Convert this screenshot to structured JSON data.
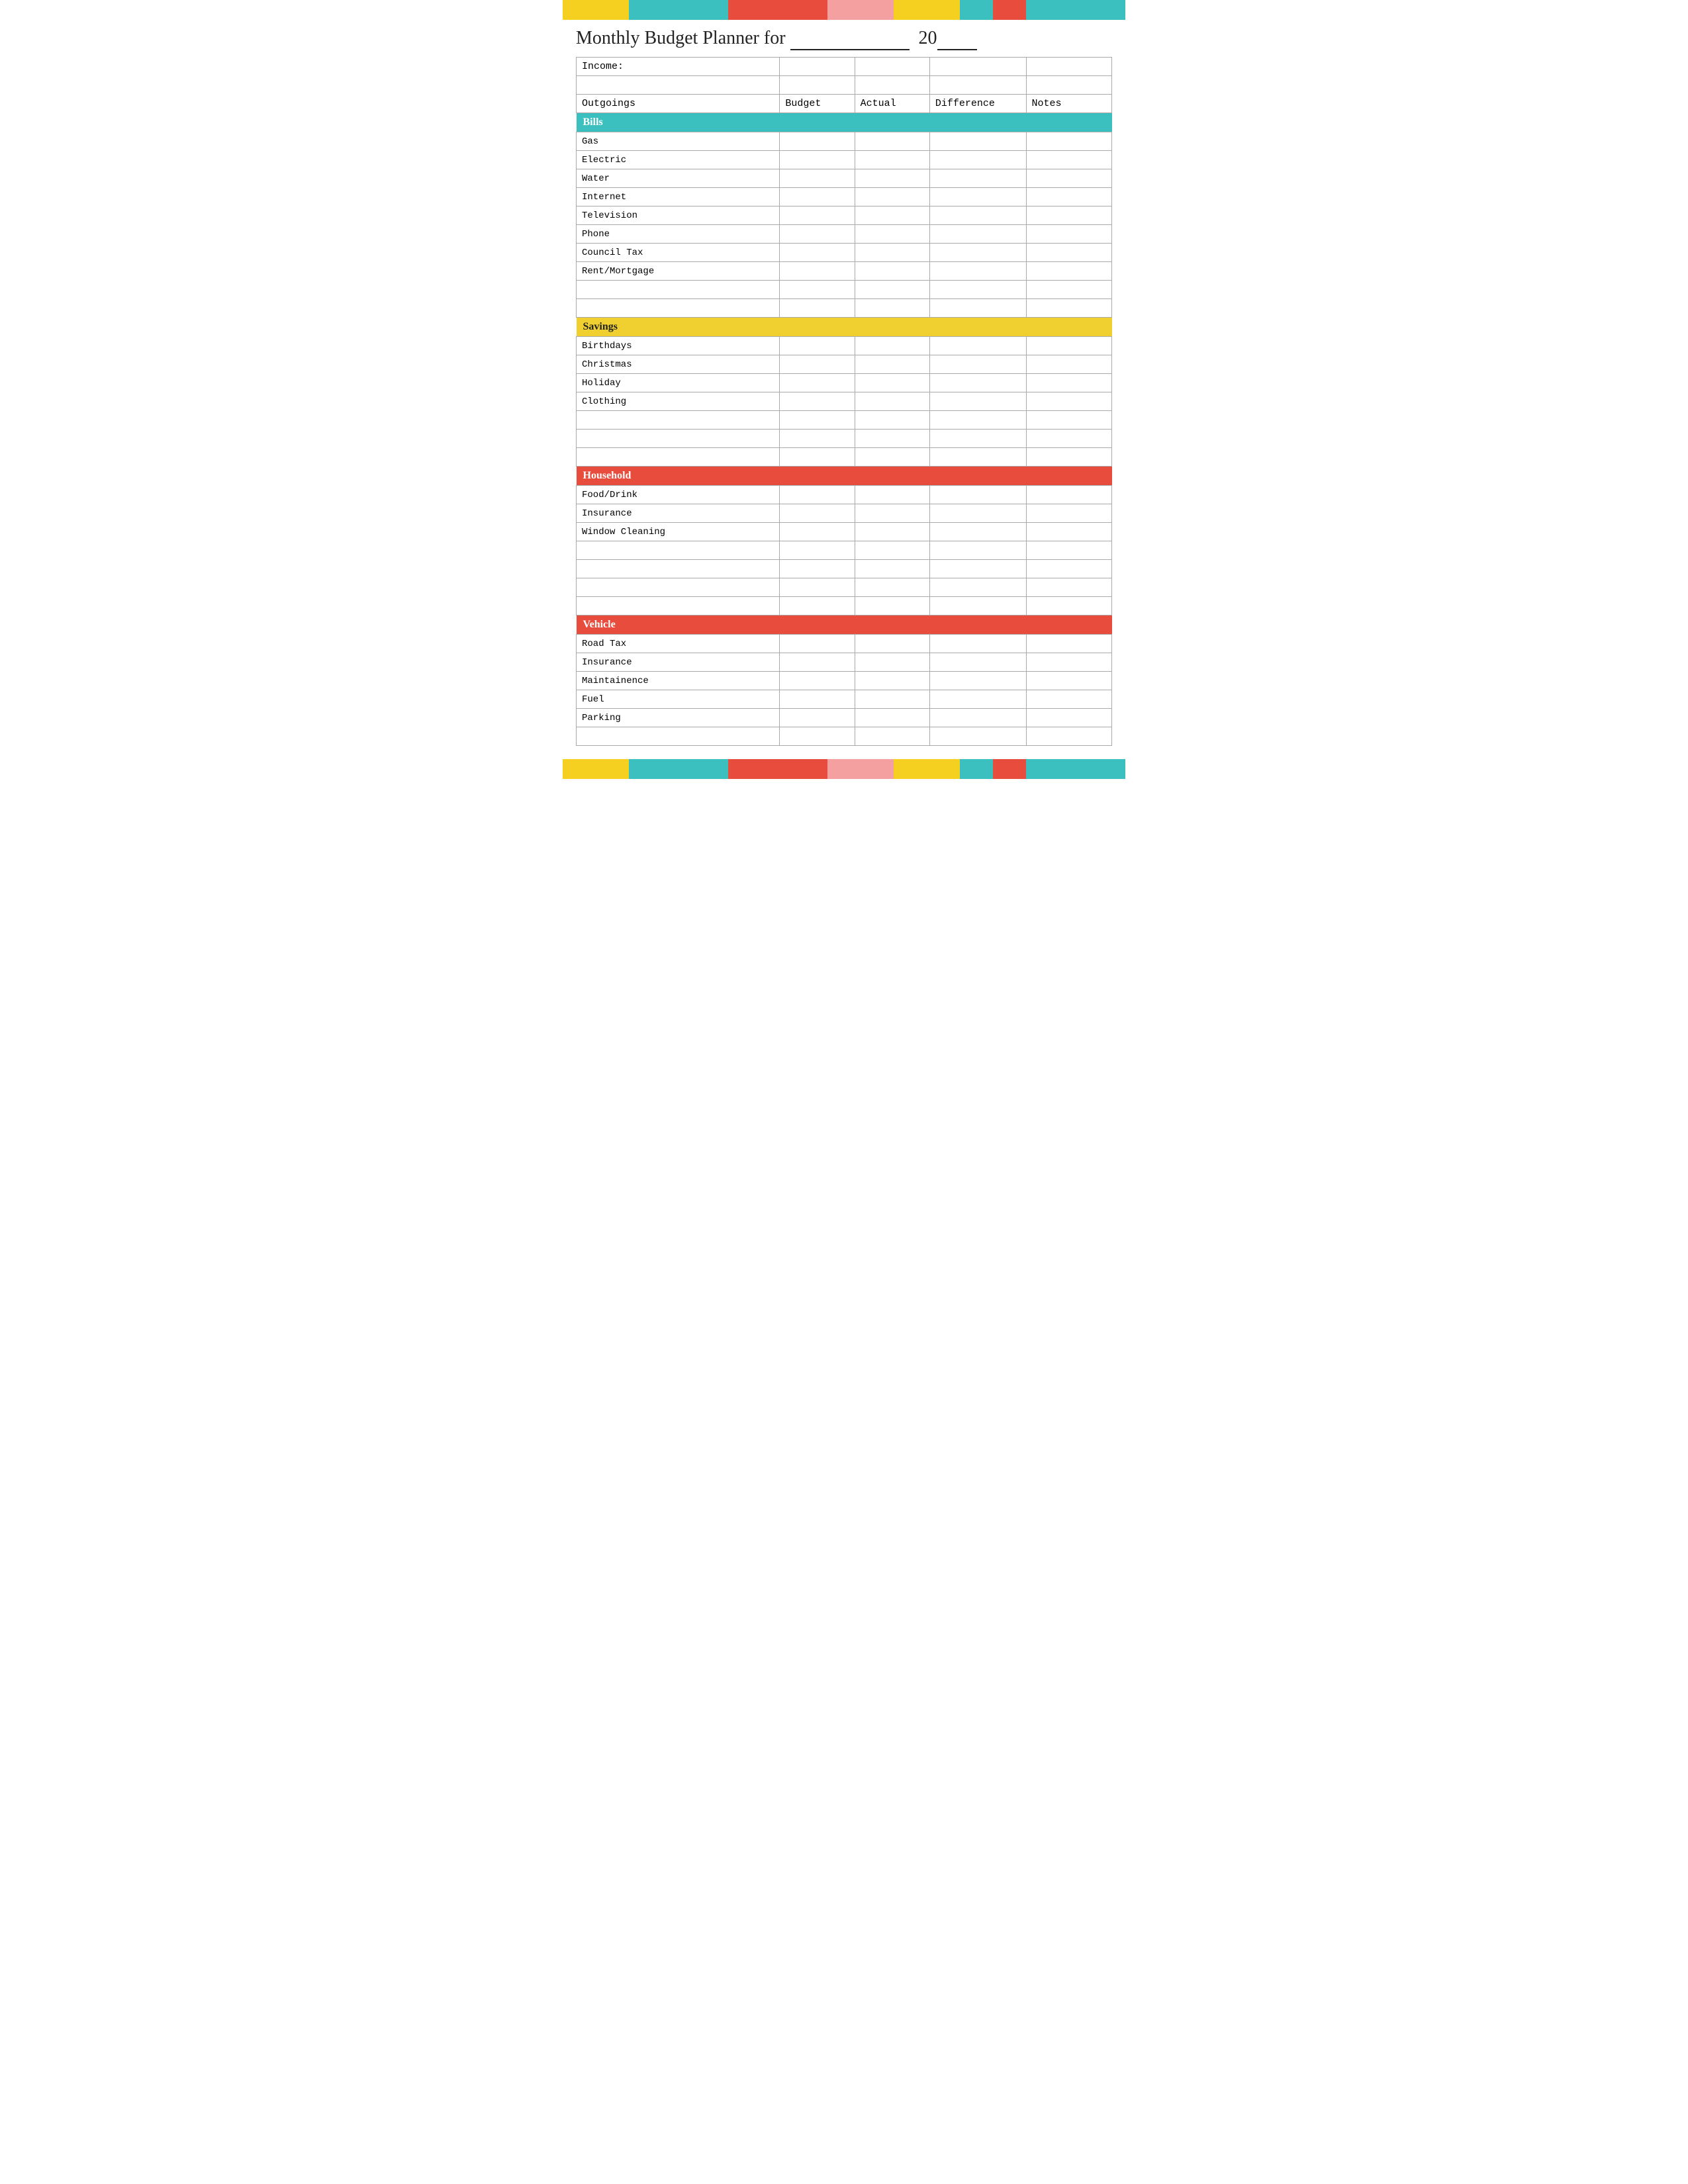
{
  "title": {
    "prefix": "Monthly Budget Planner for",
    "blank_line": "___________",
    "year_prefix": "20",
    "year_blank": "__"
  },
  "colors": {
    "yellow": "#f5d020",
    "teal": "#3bbfbf",
    "red": "#e84c3d",
    "pink": "#f4a0a0",
    "dark_yellow": "#f0c030"
  },
  "top_bar_segments": [
    {
      "color": "#f5d020",
      "flex": 2
    },
    {
      "color": "#3bbfbf",
      "flex": 3
    },
    {
      "color": "#e84c3d",
      "flex": 3
    },
    {
      "color": "#f4a0a0",
      "flex": 2
    },
    {
      "color": "#f5d020",
      "flex": 2
    },
    {
      "color": "#3bbfbf",
      "flex": 1
    },
    {
      "color": "#e84c3d",
      "flex": 1
    },
    {
      "color": "#3bbfbf",
      "flex": 3
    }
  ],
  "bottom_bar_segments": [
    {
      "color": "#f5d020",
      "flex": 2
    },
    {
      "color": "#3bbfbf",
      "flex": 3
    },
    {
      "color": "#e84c3d",
      "flex": 3
    },
    {
      "color": "#f4a0a0",
      "flex": 2
    },
    {
      "color": "#f5d020",
      "flex": 2
    },
    {
      "color": "#3bbfbf",
      "flex": 1
    },
    {
      "color": "#e84c3d",
      "flex": 1
    },
    {
      "color": "#3bbfbf",
      "flex": 3
    }
  ],
  "table": {
    "income_label": "Income:",
    "columns": {
      "outgoings": "Outgoings",
      "budget": "Budget",
      "actual": "Actual",
      "difference": "Difference",
      "notes": "Notes"
    },
    "sections": [
      {
        "name": "Bills",
        "class": "section-bills",
        "items": [
          "Gas",
          "Electric",
          "Water",
          "Internet",
          "Television",
          "Phone",
          "Council Tax",
          "Rent/Mortgage",
          "",
          ""
        ]
      },
      {
        "name": "Savings",
        "class": "section-savings",
        "items": [
          "Birthdays",
          "Christmas",
          "Holiday",
          "Clothing",
          "",
          "",
          ""
        ]
      },
      {
        "name": "Household",
        "class": "section-household",
        "items": [
          "Food/Drink",
          "Insurance",
          "Window Cleaning",
          "",
          "",
          "",
          ""
        ]
      },
      {
        "name": "Vehicle",
        "class": "section-vehicle",
        "items": [
          "Road Tax",
          "Insurance",
          "Maintainence",
          "Fuel",
          "Parking",
          ""
        ]
      }
    ]
  }
}
